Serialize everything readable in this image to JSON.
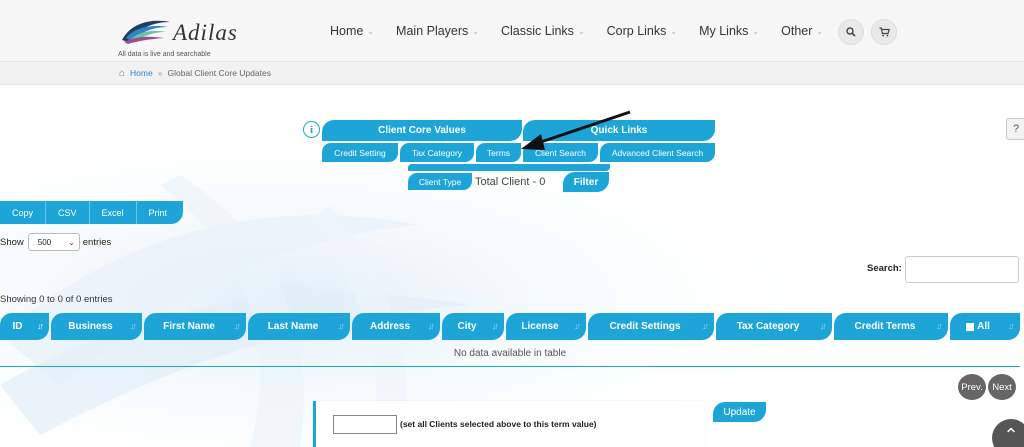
{
  "header": {
    "brand": "Adilas",
    "tagline": "All data is live and searchable",
    "nav": [
      {
        "label": "Home"
      },
      {
        "label": "Main Players"
      },
      {
        "label": "Classic Links"
      },
      {
        "label": "Corp Links"
      },
      {
        "label": "My Links"
      },
      {
        "label": "Other"
      }
    ],
    "search_icon": "search-icon",
    "cart_icon": "cart-icon"
  },
  "breadcrumb": {
    "home": "Home",
    "separator": "»",
    "current": "Global Client Core Updates"
  },
  "toolbar": {
    "core_values": "Client Core Values",
    "quick_links": "Quick Links",
    "credit_setting": "Credit Setting",
    "tax_category": "Tax Category",
    "terms": "Terms",
    "client_search": "Client Search",
    "advanced_client_search": "Advanced Client Search",
    "client_type": "Client Type",
    "total_client": "Total Client - 0",
    "filter": "Filter",
    "info_symbol": "i",
    "help_symbol": "?"
  },
  "export": {
    "buttons": [
      "Copy",
      "CSV",
      "Excel",
      "Print"
    ]
  },
  "table_controls": {
    "show_label": "Show",
    "page_size": "500",
    "entries_label": "entries",
    "search_label": "Search:",
    "showing": "Showing 0 to 0 of 0 entries"
  },
  "table": {
    "columns": [
      "ID",
      "Business",
      "First Name",
      "Last Name",
      "Address",
      "City",
      "License",
      "Credit Settings",
      "Tax Category",
      "Credit Terms",
      "All"
    ],
    "empty_message": "No data available in table"
  },
  "pagination": {
    "prev": "Prev.",
    "next": "Next"
  },
  "update": {
    "hint": "(set all Clients selected above to this term value)",
    "button": "Update"
  },
  "colors": {
    "accent": "#1ea5d8",
    "header_bg": "#f7f7f7",
    "pager": "#666666"
  }
}
